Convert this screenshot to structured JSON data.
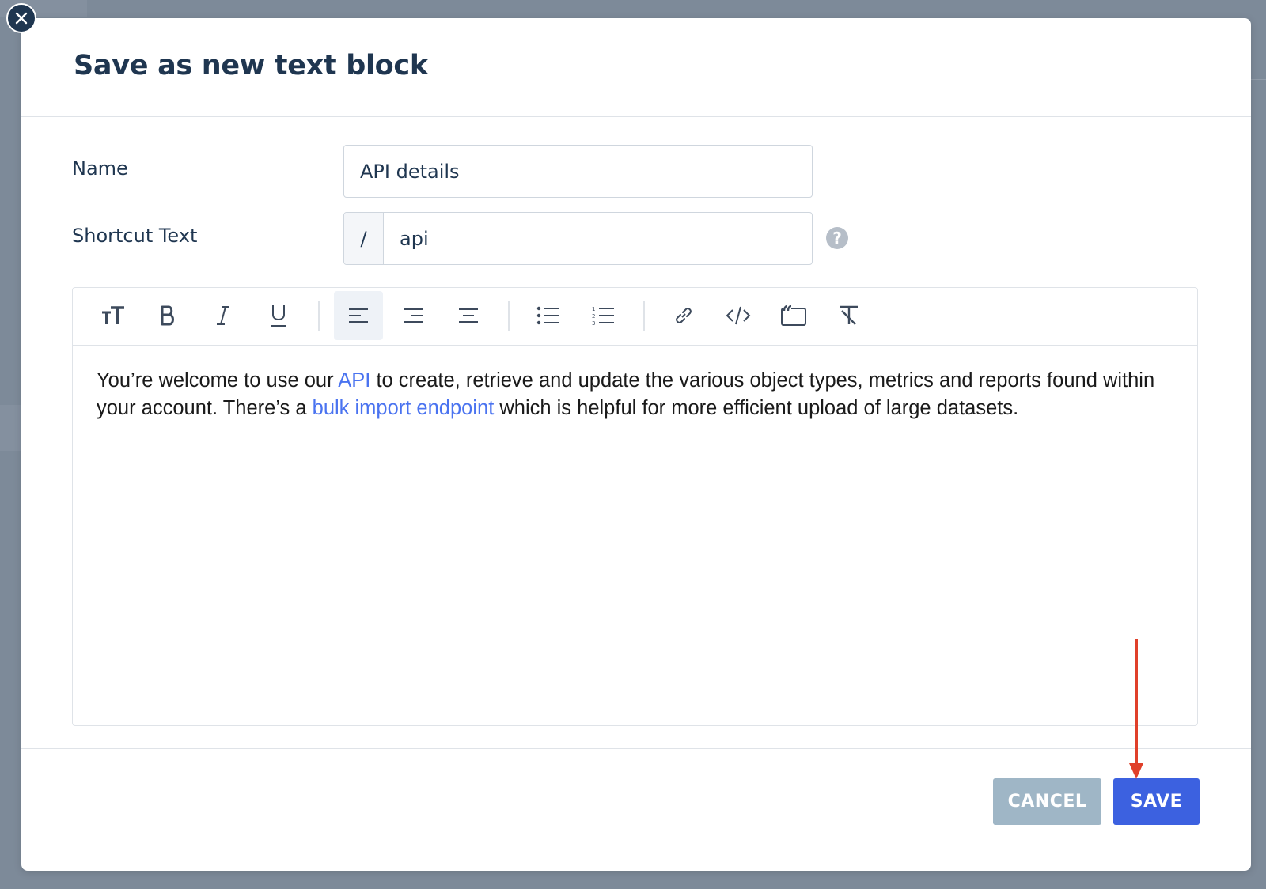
{
  "dialog": {
    "title": "Save as new text block",
    "close_icon": "close-icon"
  },
  "form": {
    "name_label": "Name",
    "name_value": "API details",
    "shortcut_label": "Shortcut Text",
    "shortcut_prefix": "/",
    "shortcut_value": "api",
    "help_glyph": "?"
  },
  "toolbar": {
    "buttons": [
      "text-size-icon",
      "bold-icon",
      "italic-icon",
      "underline-icon",
      "align-left-icon",
      "align-right-icon",
      "align-center-icon",
      "bullet-list-icon",
      "numbered-list-icon",
      "link-icon",
      "code-icon",
      "quote-icon",
      "clear-format-icon"
    ],
    "active": "align-left-icon"
  },
  "editor": {
    "text_1": "You’re welcome to use our ",
    "link_1": "API",
    "text_2": " to create, retrieve and update the various object types, metrics and reports found within your account. There’s a ",
    "link_2": "bulk import endpoint",
    "text_3": " which is helpful for more efficient upload of large datasets."
  },
  "footer": {
    "cancel_label": "CANCEL",
    "save_label": "SAVE"
  },
  "colors": {
    "primary": "#3c61e0",
    "cancel": "#9fb6c6",
    "link": "#4a73f0",
    "annotation_arrow": "#e0402a",
    "title": "#1f3650"
  }
}
